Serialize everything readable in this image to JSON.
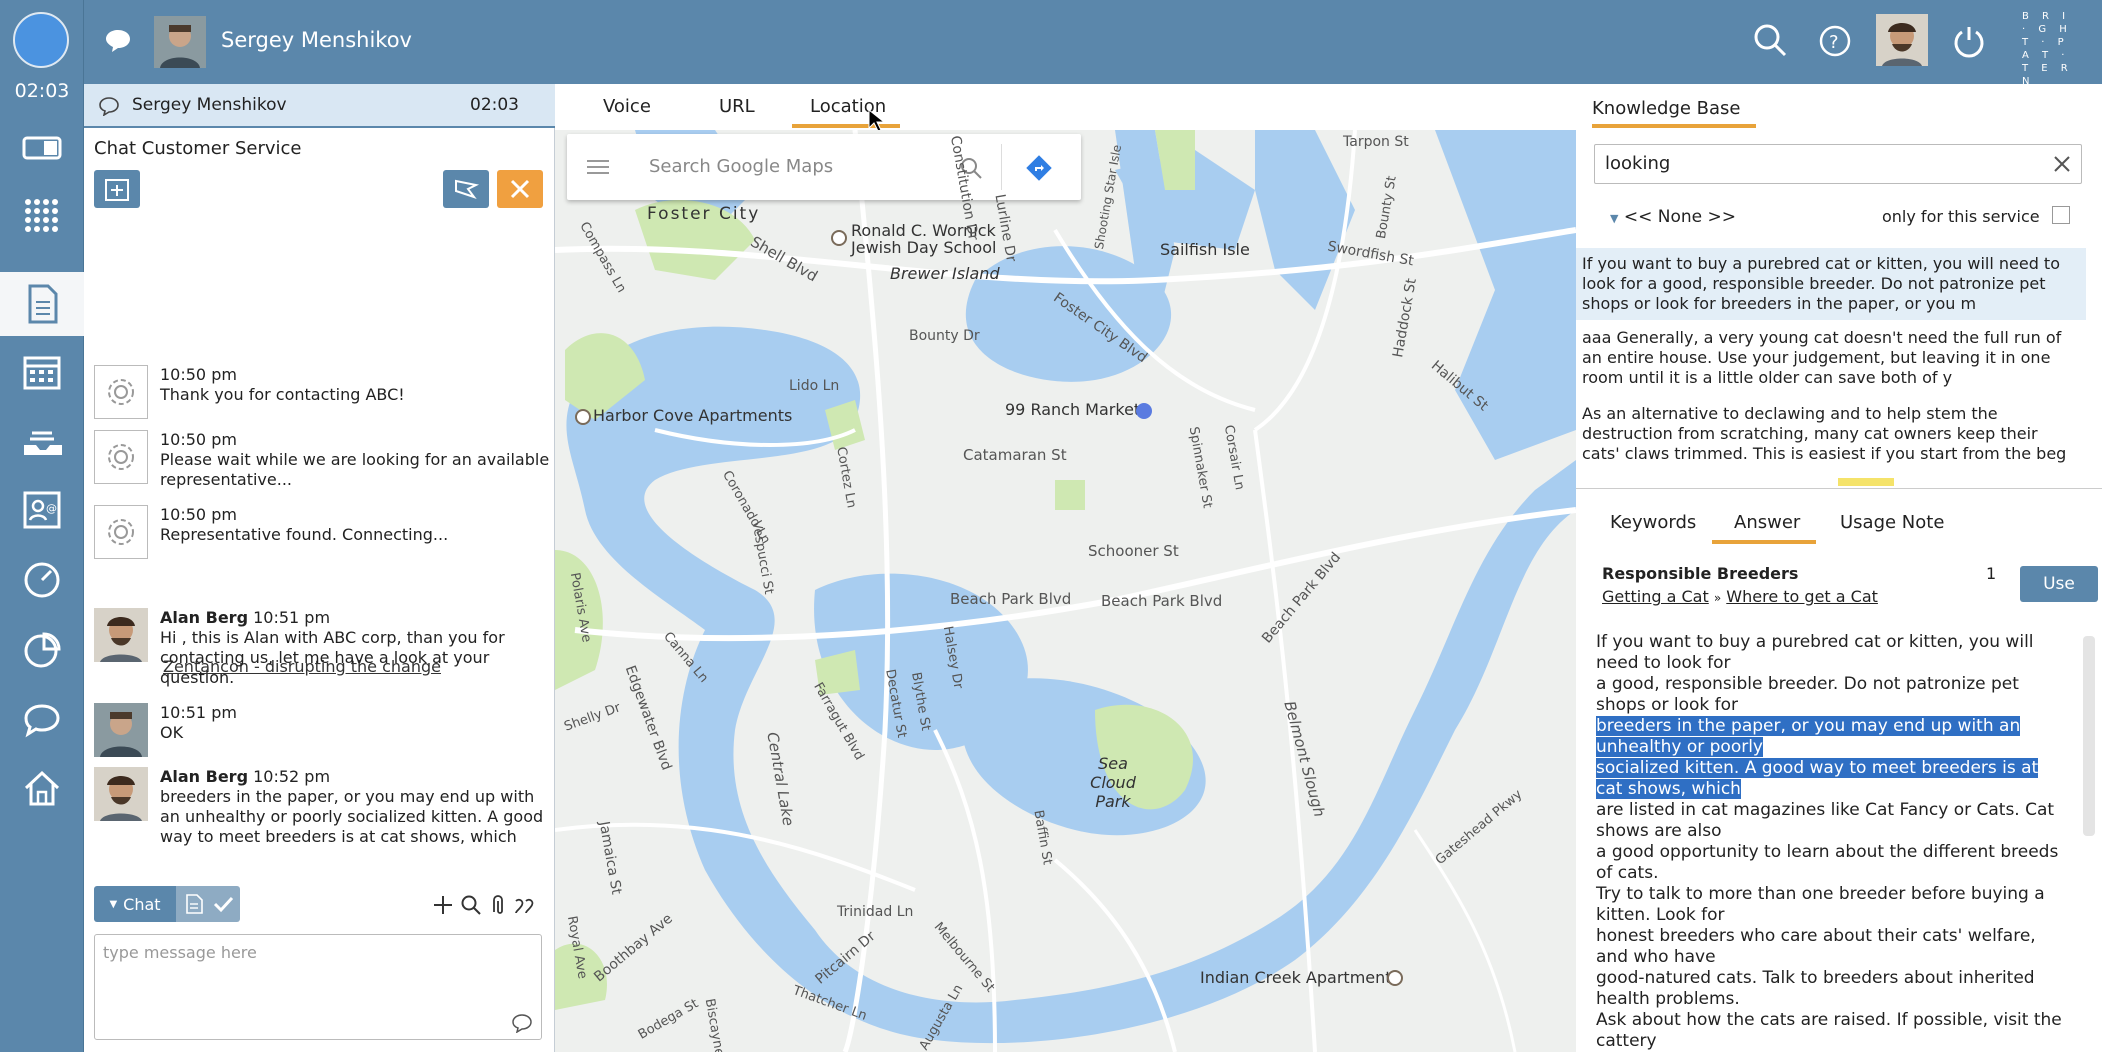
{
  "topbar": {
    "agent_name": "Sergey Menshikov",
    "brand_text": "B R I · G H T · P A T · T E R N",
    "icons": [
      "chat-bubble-icon",
      "search-icon",
      "help-icon",
      "power-icon"
    ]
  },
  "sidebar": {
    "timer": "02:03",
    "items": [
      "window-icon",
      "grid-icon",
      "document-icon",
      "calendar-icon",
      "inbox-icon",
      "contact-card-icon",
      "gauge-icon",
      "pie-chart-icon",
      "speech-bubble-icon",
      "home-icon"
    ]
  },
  "chat": {
    "header_name": "Sergey Menshikov",
    "header_time": "02:03",
    "service": "Chat Customer Service",
    "messages": [
      {
        "time": "10:50 pm",
        "text": "Thank you for contacting ABC!"
      },
      {
        "time": "10:50 pm",
        "text": "Please wait while we are looking for an available representative..."
      },
      {
        "time": "10:50 pm",
        "text": "Representative found. Connecting..."
      },
      {
        "author": "Alan Berg",
        "time": "10:51 pm",
        "text": "Hi , this is Alan with ABC corp, than you for contacting us, let me have a look at your question."
      },
      {
        "time": "10:51 pm",
        "text": "OK"
      },
      {
        "author": "Alan Berg",
        "time": "10:52 pm",
        "text": "breeders in the paper, or you may end up with an unhealthy or poorly socialized kitten. A good way to meet breeders is at cat shows, which"
      }
    ],
    "link_text": "Zentancon - disrupting the change",
    "chat_button": "Chat",
    "input_placeholder": "type message here"
  },
  "center": {
    "tabs": [
      "Voice",
      "URL",
      "Location"
    ],
    "active_tab": "Location",
    "map": {
      "search_placeholder": "Search Google Maps",
      "labels": {
        "foster_city": "Foster City",
        "wornick": "Ronald C. Wornick Jewish Day School",
        "brewer": "Brewer Island",
        "sailfish": "Sailfish Isle",
        "harbor": "Harbor Cove Apartments",
        "ranch": "99 Ranch Market",
        "catamaran": "Catamaran St",
        "schooner": "Schooner St",
        "beachpark1": "Beach Park Blvd",
        "beachpark2": "Beach Park Blvd",
        "seacloud": "Sea Cloud Park",
        "indian": "Indian Creek Apartments",
        "shell": "Shell Blvd",
        "bounty": "Bounty Dr",
        "lido": "Lido Ln",
        "tarpon": "Tarpon St",
        "swordfish": "Swordfish St",
        "trinidad": "Trinidad Ln",
        "central": "Central Lake",
        "belmont": "Belmont Slough",
        "fostercity": "Foster City Blvd",
        "pitcairn": "Pitcairn Dr",
        "edgewater": "Edgewater Blvd",
        "beachpark3": "Beach Park Blvd",
        "halibut": "Halibut St",
        "haddock": "Haddock St",
        "constitution": "Constitution Dr",
        "lurline": "Lurline Dr",
        "shooting": "Shooting Star Isle",
        "boothbay": "Boothbay Ave",
        "jamaica": "Jamaica St",
        "spinnaker": "Spinnaker St",
        "corsair": "Corsair Ln",
        "cortez": "Cortez Ln",
        "halsey": "Halsey Dr",
        "blythe": "Blythe St",
        "decatur": "Decatur St",
        "farragut": "Farragut Blvd",
        "baffin": "Baffin St",
        "melbourne": "Melbourne St",
        "gateshead": "Gateshead Pkwy",
        "bodega": "Bodega St",
        "biscayne": "Biscayne",
        "thatcher": "Thatcher Ln",
        "augusta": "Augusta Ln",
        "compass": "Compass Ln",
        "canna": "Canna Ln",
        "vespucci": "Vespucci St",
        "coronado": "Coronado Ln",
        "shelly": "Shelly Dr",
        "polaris": "Polaris Ave",
        "royal": "Royal Ave",
        "bounty2": "Bounty St"
      }
    }
  },
  "knowledge_base": {
    "title": "Knowledge Base",
    "search_value": "looking",
    "filter": "<< None >>",
    "only_service": "only for this service",
    "results": [
      "If you want to buy a purebred cat or kitten, you will need to look for a good, responsible breeder. Do not patronize pet shops or look for breeders in the paper, or you m",
      "aaa Generally, a very young cat doesn't need the full run of an entire house. Use your judgement, but leaving it in one room until it is a little older can save both of y",
      "As an alternative to declawing and to help stem the destruction from scratching, many cat owners keep their cats' claws trimmed. This is easiest if you start from the beg"
    ],
    "tabs": [
      "Keywords",
      "Answer",
      "Usage Note"
    ],
    "answer_title": "Responsible Breeders",
    "answer_count": "1",
    "use_button": "Use",
    "crumb_1": "Getting a Cat",
    "crumb_sep": "»",
    "crumb_2": "Where to get a Cat",
    "answer_lines": [
      "If you want to buy a purebred cat or kitten, you will need to look for",
      "a good, responsible breeder. Do not patronize pet shops or look for",
      "breeders in the paper, or you may end up with an unhealthy or poorly",
      "socialized kitten. A good way to meet breeders is at cat shows, which",
      "are listed in cat magazines like Cat Fancy or Cats. Cat shows are also",
      "a good opportunity to learn about the different breeds of cats.",
      "Try to talk to more than one breeder before buying a kitten. Look for",
      "honest breeders who care about their cats' welfare, and who have",
      "good-natured cats. Talk to breeders about inherited health problems.",
      "Ask about how the cats are raised. If possible, visit the cattery"
    ],
    "highlighted_lines": [
      2,
      3
    ]
  },
  "colors": {
    "accent": "#5b87ab",
    "tab_underline": "#e8a33a",
    "close_orange": "#f0a040",
    "highlight": "#2f6fc4",
    "water": "#a8cdf0",
    "park": "#cfe8b2"
  }
}
